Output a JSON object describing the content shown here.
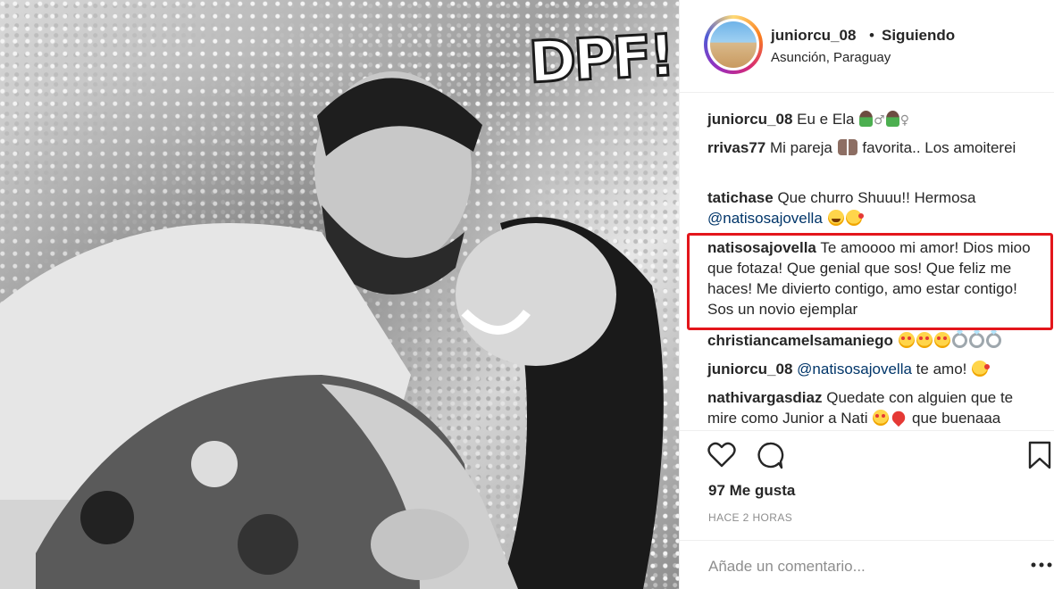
{
  "photo": {
    "sign_text": "DPF!"
  },
  "header": {
    "username": "juniorcu_08",
    "separator": "•",
    "follow_state": "Siguiendo",
    "location": "Asunción, Paraguay"
  },
  "comments": [
    {
      "user": "juniorcu_08",
      "text": "Eu e Ela",
      "emojis": [
        "person",
        "male-sign",
        "person",
        "female-sign"
      ]
    },
    {
      "user": "rrivas77",
      "text_before": "Mi pareja",
      "text_after": "favorita.. Los amoiterei",
      "emojis": [
        "couple"
      ]
    },
    {
      "user": "tatichase",
      "text": "Que churro Shuuu!! Hermosa",
      "mention": "@natisosajovella",
      "emojis": [
        "grin",
        "kiss"
      ]
    },
    {
      "user": "natisosajovella",
      "text": "Te amoooo mi amor! Dios mioo que fotaza! Que genial que sos! Que feliz me haces! Me divierto contigo, amo estar contigo! Sos un novio ejemplar",
      "highlighted": true
    },
    {
      "user": "christiancamelsamaniego",
      "emojis": [
        "heart-eyes",
        "heart-eyes",
        "heart-eyes",
        "ring",
        "ring",
        "ring"
      ]
    },
    {
      "user": "juniorcu_08",
      "mention": "@natisosajovella",
      "text": "te amo!",
      "emojis": [
        "kiss"
      ]
    },
    {
      "user": "nathivargasdiaz",
      "text": "Quedate con alguien que te mire como Junior a Nati",
      "text_after": "que buenaaa",
      "emojis": [
        "heart-eyes",
        "heart"
      ]
    }
  ],
  "symbols": {
    "male": "♂",
    "female": "♀"
  },
  "actions": {
    "like_icon": "heart-icon",
    "comment_icon": "comment-bubble-icon",
    "save_icon": "bookmark-icon"
  },
  "likes": "97 Me gusta",
  "time_ago": "HACE 2 HORAS",
  "add_comment": {
    "placeholder": "Añade un comentario..."
  },
  "colors": {
    "highlight": "#e3161b",
    "mention": "#003569",
    "muted": "#8e8e8e"
  }
}
